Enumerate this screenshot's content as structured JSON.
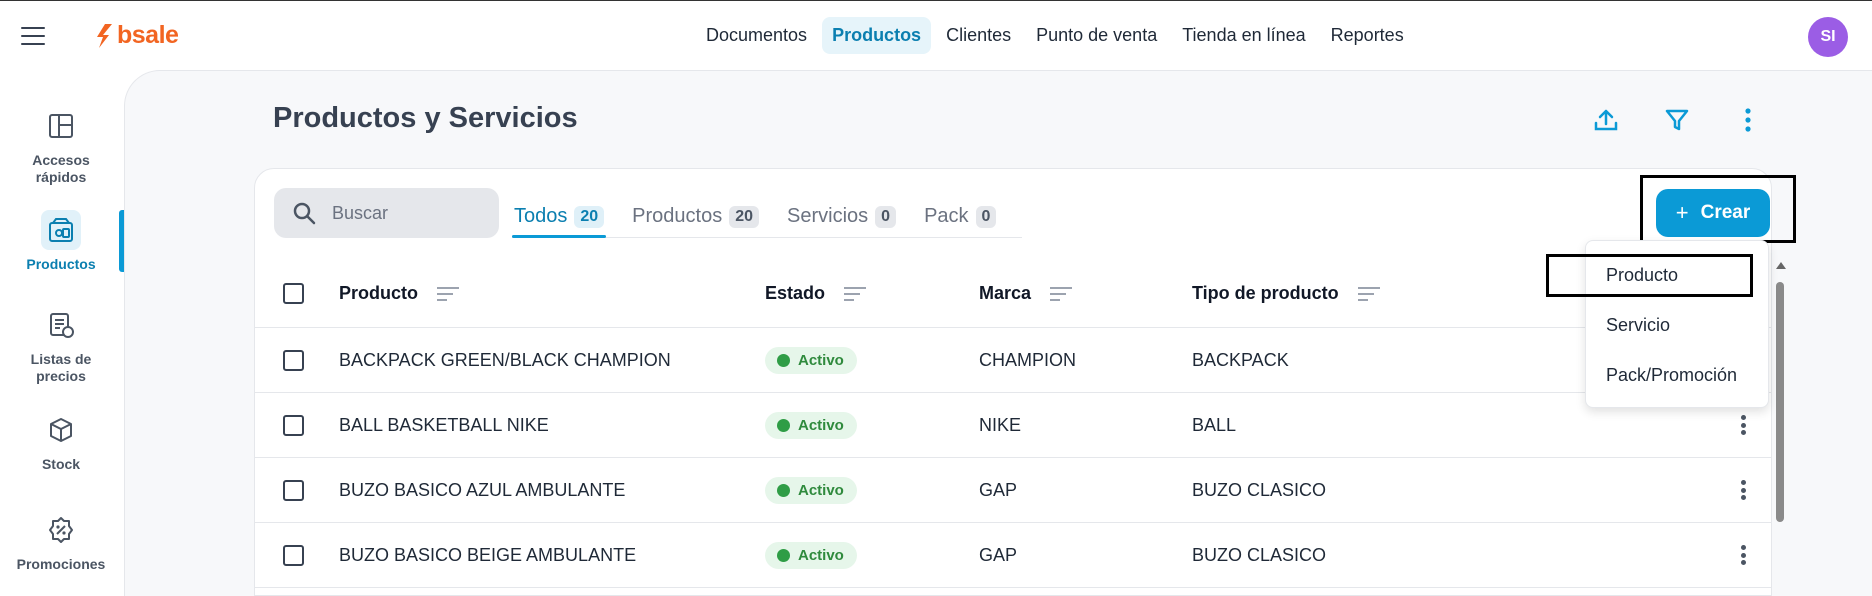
{
  "topbar": {
    "logo_text": "bsale",
    "nav": [
      "Documentos",
      "Productos",
      "Clientes",
      "Punto de venta",
      "Tienda en línea",
      "Reportes"
    ],
    "active_nav": "Productos",
    "avatar_initials": "SI"
  },
  "sidebar": {
    "items": [
      {
        "label": "Accesos rápidos",
        "icon": "layout-icon"
      },
      {
        "label": "Productos",
        "icon": "products-icon",
        "active": true
      },
      {
        "label": "Listas de precios",
        "icon": "price-list-icon"
      },
      {
        "label": "Stock",
        "icon": "box-icon"
      },
      {
        "label": "Promociones",
        "icon": "percent-badge-icon"
      }
    ]
  },
  "page": {
    "title": "Productos y Servicios"
  },
  "search": {
    "placeholder": "Buscar"
  },
  "tabs": [
    {
      "label": "Todos",
      "count": "20",
      "active": true
    },
    {
      "label": "Productos",
      "count": "20"
    },
    {
      "label": "Servicios",
      "count": "0"
    },
    {
      "label": "Pack",
      "count": "0"
    }
  ],
  "crear_button": {
    "label": "Crear"
  },
  "dropdown": {
    "items": [
      "Producto",
      "Servicio",
      "Pack/Promoción"
    ]
  },
  "table": {
    "columns": [
      "Producto",
      "Estado",
      "Marca",
      "Tipo de producto"
    ],
    "rows": [
      {
        "producto": "BACKPACK GREEN/BLACK CHAMPION",
        "estado": "Activo",
        "marca": "CHAMPION",
        "tipo": "BACKPACK"
      },
      {
        "producto": "BALL BASKETBALL NIKE",
        "estado": "Activo",
        "marca": "NIKE",
        "tipo": "BALL"
      },
      {
        "producto": "BUZO BASICO AZUL AMBULANTE",
        "estado": "Activo",
        "marca": "GAP",
        "tipo": "BUZO CLASICO"
      },
      {
        "producto": "BUZO BASICO BEIGE AMBULANTE",
        "estado": "Activo",
        "marca": "GAP",
        "tipo": "BUZO CLASICO"
      }
    ]
  },
  "colors": {
    "accent": "#0b9ad6",
    "brand": "#f26522",
    "status_active": "#2f9d46",
    "avatar": "#9b5de5"
  }
}
